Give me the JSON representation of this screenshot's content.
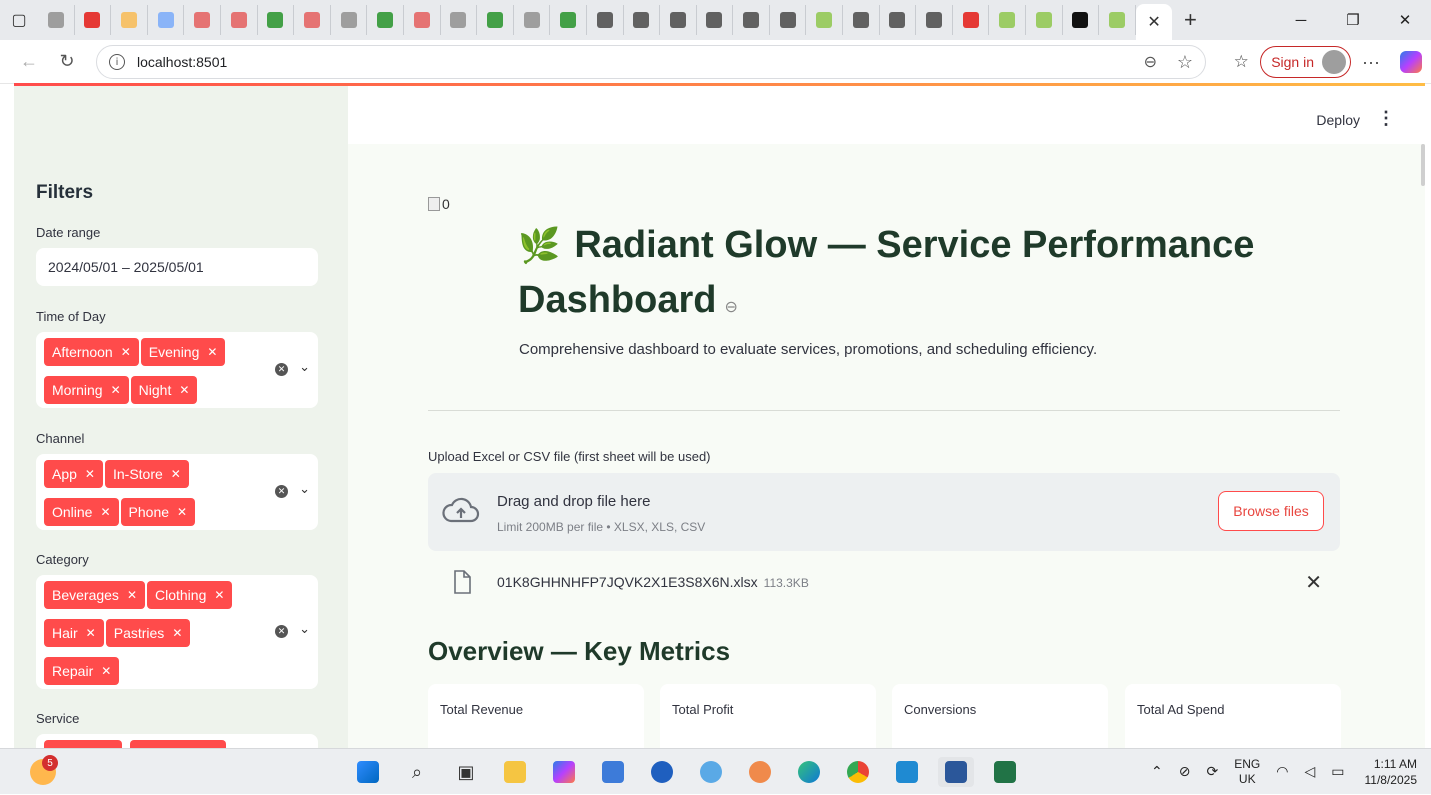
{
  "browser": {
    "tab_favicons": [
      {
        "icon": "image-icon",
        "color": "#9e9e9e"
      },
      {
        "icon": "pdf-icon",
        "color": "#e53935"
      },
      {
        "icon": "link-icon",
        "color": "#f6c26b"
      },
      {
        "icon": "search-icon",
        "color": "#8ab4f8"
      },
      {
        "icon": "info-icon",
        "color": "#e57373"
      },
      {
        "icon": "streamlit-icon",
        "color": "#e57373"
      },
      {
        "icon": "sheet-icon",
        "color": "#43a047"
      },
      {
        "icon": "streamlit-icon",
        "color": "#e57373"
      },
      {
        "icon": "doc-icon",
        "color": "#9e9e9e"
      },
      {
        "icon": "sheet-icon",
        "color": "#43a047"
      },
      {
        "icon": "streamlit-icon",
        "color": "#e57373"
      },
      {
        "icon": "doc-icon",
        "color": "#9e9e9e"
      },
      {
        "icon": "sheet-icon",
        "color": "#43a047"
      },
      {
        "icon": "doc-icon",
        "color": "#9e9e9e"
      },
      {
        "icon": "sheet-icon",
        "color": "#43a047"
      },
      {
        "icon": "github-icon",
        "color": "#616161"
      },
      {
        "icon": "github-icon",
        "color": "#616161"
      },
      {
        "icon": "github-icon",
        "color": "#616161"
      },
      {
        "icon": "github-icon",
        "color": "#616161"
      },
      {
        "icon": "github-icon",
        "color": "#616161"
      },
      {
        "icon": "github-icon",
        "color": "#616161"
      },
      {
        "icon": "leaf-icon",
        "color": "#9ccc65"
      },
      {
        "icon": "github-icon",
        "color": "#616161"
      },
      {
        "icon": "github-icon",
        "color": "#616161"
      },
      {
        "icon": "github-icon",
        "color": "#616161"
      },
      {
        "icon": "pdf-icon",
        "color": "#e53935"
      },
      {
        "icon": "leaf-icon",
        "color": "#9ccc65"
      },
      {
        "icon": "leaf-icon",
        "color": "#9ccc65"
      },
      {
        "icon": "ai-icon",
        "color": "#111111"
      },
      {
        "icon": "leaf-icon",
        "color": "#9ccc65"
      }
    ],
    "url": "localhost:8501",
    "signin_label": "Sign in"
  },
  "app": {
    "deploy_label": "Deploy",
    "broken_image_alt": "0",
    "title": "Radiant Glow — Service Performance Dashboard",
    "subtitle": "Comprehensive dashboard to evaluate services, promotions, and scheduling efficiency.",
    "upload_label": "Upload Excel or CSV file (first sheet will be used)",
    "dropzone_main": "Drag and drop file here",
    "dropzone_sub": "Limit 200MB per file • XLSX, XLS, CSV",
    "browse_label": "Browse files",
    "uploaded_file": {
      "name": "01K8GHHNHFP7JQVK2X1E3S8X6N.xlsx",
      "size": "113.3KB"
    },
    "overview_heading": "Overview — Key Metrics",
    "metrics": [
      {
        "label": "Total Revenue"
      },
      {
        "label": "Total Profit"
      },
      {
        "label": "Conversions"
      },
      {
        "label": "Total Ad Spend"
      }
    ],
    "accent": "#ff4b4b"
  },
  "sidebar": {
    "title": "Filters",
    "date_label": "Date range",
    "date_value": "2024/05/01 – 2025/05/01",
    "time_label": "Time of Day",
    "time_chips": [
      "Afternoon",
      "Evening",
      "Morning",
      "Night"
    ],
    "channel_label": "Channel",
    "channel_chips": [
      "App",
      "In-Store",
      "Online",
      "Phone"
    ],
    "category_label": "Category",
    "category_chips": [
      "Beverages",
      "Clothing",
      "Hair",
      "Pastries",
      "Repair"
    ],
    "service_label": "Service"
  },
  "taskbar": {
    "weather_badge": "5",
    "lang_line1": "ENG",
    "lang_line2": "UK",
    "time": "1:11 AM",
    "date": "11/8/2025"
  }
}
